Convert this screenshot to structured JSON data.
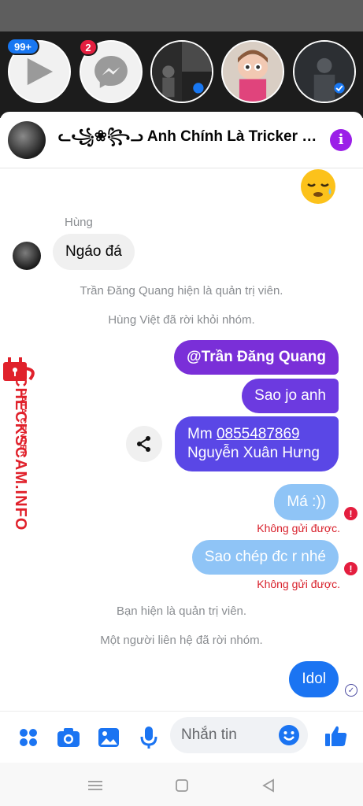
{
  "chat_heads": {
    "video_badge": "99+",
    "messenger_badge": "2"
  },
  "header": {
    "title": "ᓚ꧁❀꧂ᓗ Anh Chính Là Tricker Vi..."
  },
  "messages": {
    "incoming_sender": "Hùng",
    "incoming_text": "Ngáo đá",
    "system_1": "Trần Đăng Quang hiện là quản trị viên.",
    "system_2": "Hùng Việt đã rời khỏi nhóm.",
    "out_mention": "@Trần Đăng Quang",
    "out_2": "Sao jo anh",
    "out_3_prefix": "Mm ",
    "out_3_phone": "0855487869",
    "out_3_name": "Nguyễn Xuân Hưng",
    "out_4": "Má :))",
    "out_5": "Sao chép đc r nhé",
    "failed_label": "Không gửi được.",
    "system_3": "Bạn hiện là quản trị viên.",
    "system_4": "Một người liên hệ đã rời nhóm.",
    "out_6": "Idol"
  },
  "watermark": {
    "line1": "DATA CENTER",
    "line2": "CHECKSCAM.INFO"
  },
  "composer": {
    "placeholder": "Nhắn tin"
  },
  "colors": {
    "accent": "#1b74f2",
    "purple_info": "#9b1fe8",
    "error": "#e41e3f"
  }
}
